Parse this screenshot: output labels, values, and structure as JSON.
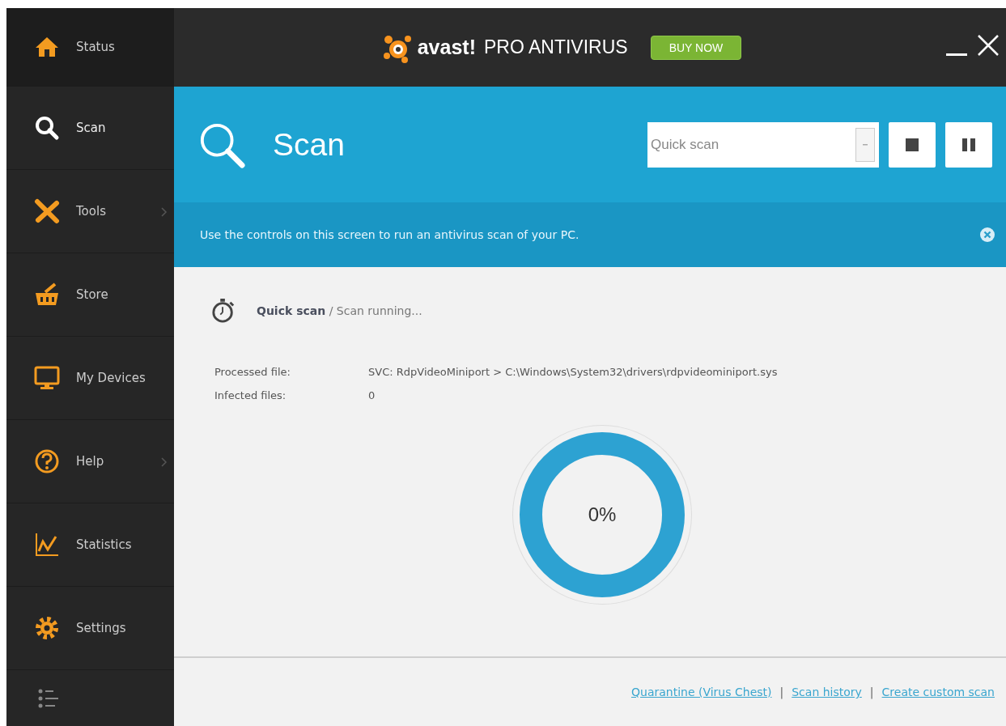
{
  "window": {
    "brand": "avast!",
    "product": "PRO ANTIVIRUS",
    "buy_button": "BUY NOW"
  },
  "sidebar": {
    "items": [
      {
        "label": "Status",
        "selected": false,
        "has_submenu": false
      },
      {
        "label": "Scan",
        "selected": true,
        "has_submenu": false
      },
      {
        "label": "Tools",
        "selected": false,
        "has_submenu": true
      },
      {
        "label": "Store",
        "selected": false,
        "has_submenu": false
      },
      {
        "label": "My Devices",
        "selected": false,
        "has_submenu": false
      },
      {
        "label": "Help",
        "selected": false,
        "has_submenu": true
      },
      {
        "label": "Statistics",
        "selected": false,
        "has_submenu": false
      },
      {
        "label": "Settings",
        "selected": false,
        "has_submenu": false
      }
    ]
  },
  "header": {
    "title": "Scan",
    "scan_type": {
      "value": "Quick scan"
    }
  },
  "info_bar": {
    "text": "Use the controls on this screen to run an antivirus scan of your PC."
  },
  "scan": {
    "status": "**Quick scan** / Scan running...",
    "details": [
      {
        "label": "Processed file:",
        "value": "SVC: RdpVideoMiniport > C:\\Windows\\System32\\drivers\\rdpvideominiport.sys"
      },
      {
        "label": "Infected files:",
        "value": "0"
      }
    ],
    "progress": {
      "reading": "0%"
    }
  },
  "footer": [
    {
      "kind": "link",
      "text": "Quarantine (Virus Chest)"
    },
    {
      "kind": "separator",
      "text": "|"
    },
    {
      "kind": "link",
      "text": "Scan history"
    },
    {
      "kind": "separator",
      "text": "|"
    },
    {
      "kind": "link",
      "text": "Create custom scan"
    }
  ]
}
